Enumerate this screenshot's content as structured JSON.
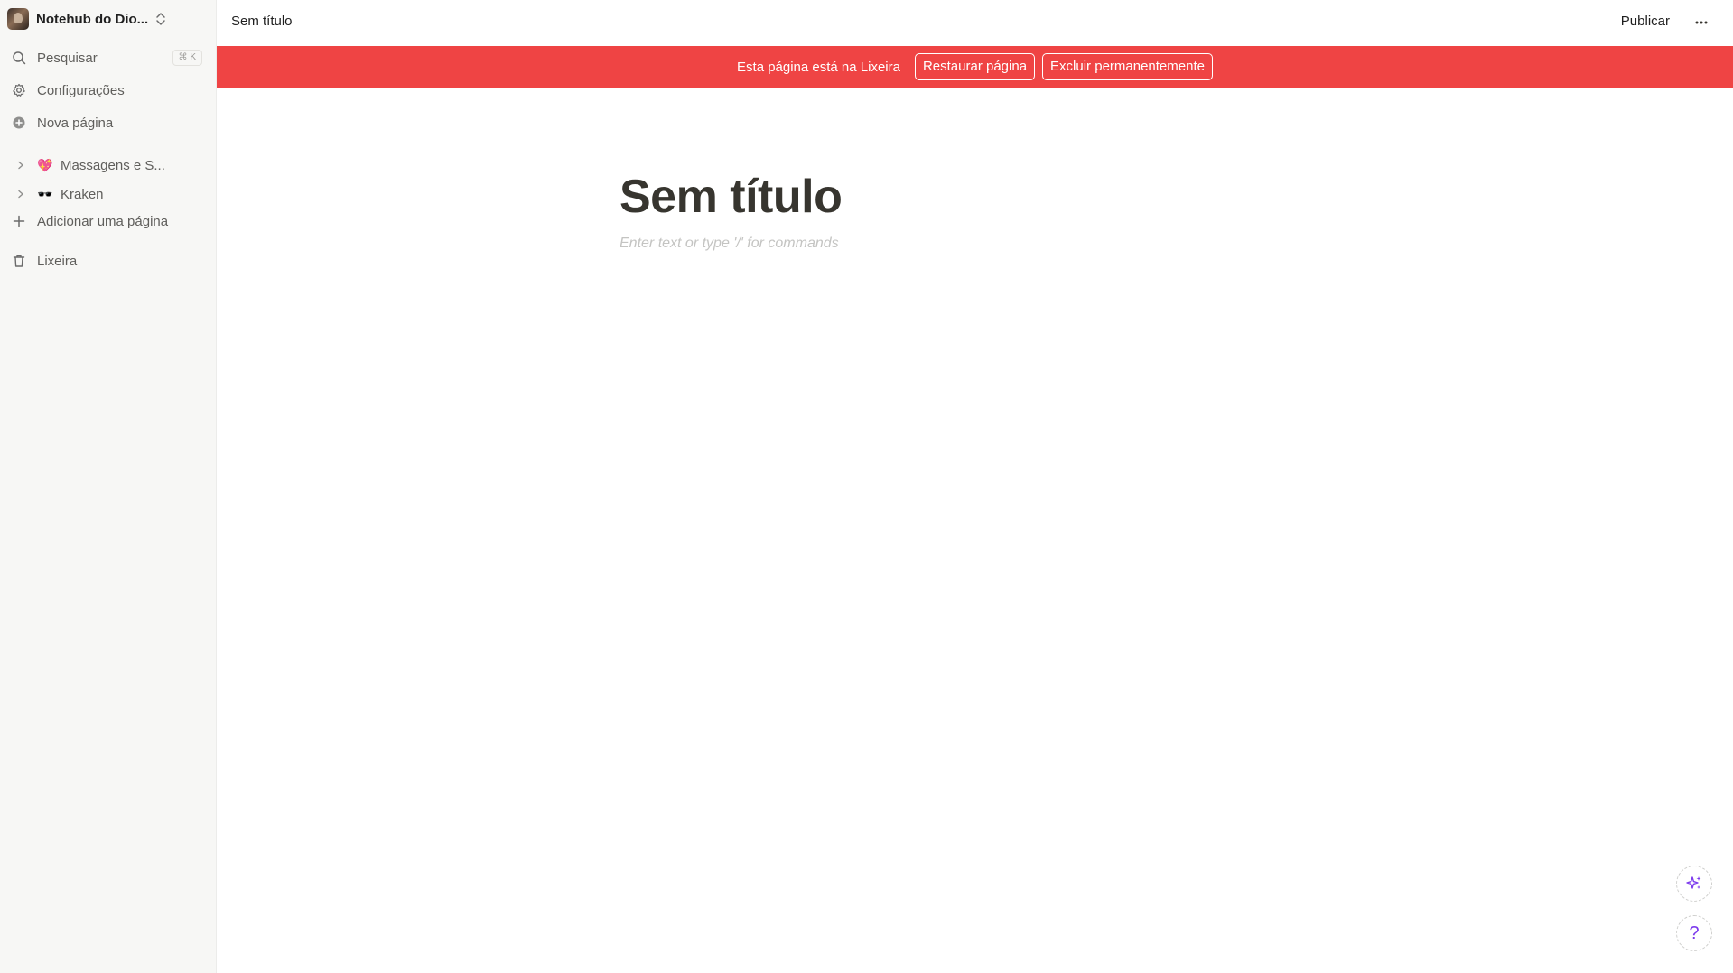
{
  "sidebar": {
    "workspace_name": "Notehub do Dio...",
    "search_label": "Pesquisar",
    "search_shortcut": "⌘ K",
    "settings_label": "Configurações",
    "new_page_label": "Nova página",
    "pages": [
      {
        "emoji": "💖",
        "label": "Massagens e S..."
      },
      {
        "emoji": "🕶️",
        "label": "Kraken"
      }
    ],
    "add_page_label": "Adicionar uma página",
    "trash_label": "Lixeira"
  },
  "topbar": {
    "breadcrumb": "Sem título",
    "publish_label": "Publicar"
  },
  "banner": {
    "text": "Esta página está na Lixeira",
    "restore_label": "Restaurar página",
    "delete_label": "Excluir permanentemente",
    "color": "#ef4444"
  },
  "page": {
    "title": "Sem título",
    "body_placeholder": "Enter text or type '/' for commands"
  },
  "floating": {
    "ai_icon": "sparkles-icon",
    "help_label": "?"
  }
}
